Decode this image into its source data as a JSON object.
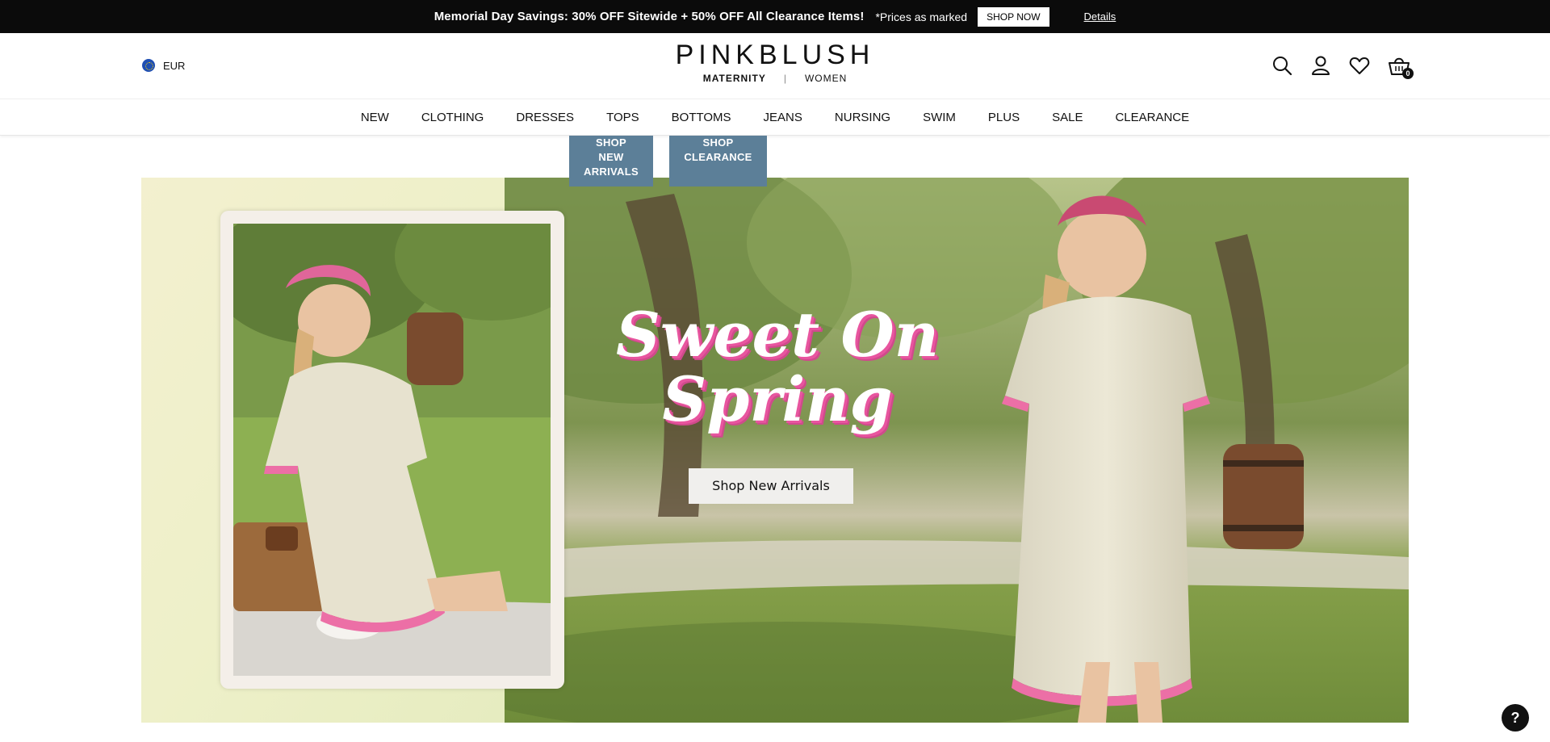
{
  "promo": {
    "headline": "Memorial Day Savings: 30% OFF Sitewide + 50% OFF All Clearance Items!",
    "note": "*Prices as marked",
    "shop_label": "SHOP NOW",
    "details_label": "Details"
  },
  "header": {
    "currency": "EUR",
    "brand": "PINKBLUSH",
    "sub_maternity": "MATERNITY",
    "sub_separator": "|",
    "sub_women": "WOMEN",
    "cart_count": "0"
  },
  "nav": {
    "items": [
      "NEW",
      "CLOTHING",
      "DRESSES",
      "TOPS",
      "BOTTOMS",
      "JEANS",
      "NURSING",
      "SWIM",
      "PLUS",
      "SALE",
      "CLEARANCE"
    ]
  },
  "mini_buttons": {
    "new_arrivals": [
      "SHOP",
      "NEW",
      "ARRIVALS"
    ],
    "clearance": [
      "SHOP",
      "CLEARANCE"
    ]
  },
  "hero": {
    "headline_line1": "Sweet On",
    "headline_line2": "Spring",
    "cta_label": "Shop New Arrivals"
  },
  "help": {
    "label": "?"
  },
  "colors": {
    "promo_bg": "#0b0b0b",
    "mini_button_bg": "#5c7f98",
    "headline_shadow": "#e8559f"
  }
}
